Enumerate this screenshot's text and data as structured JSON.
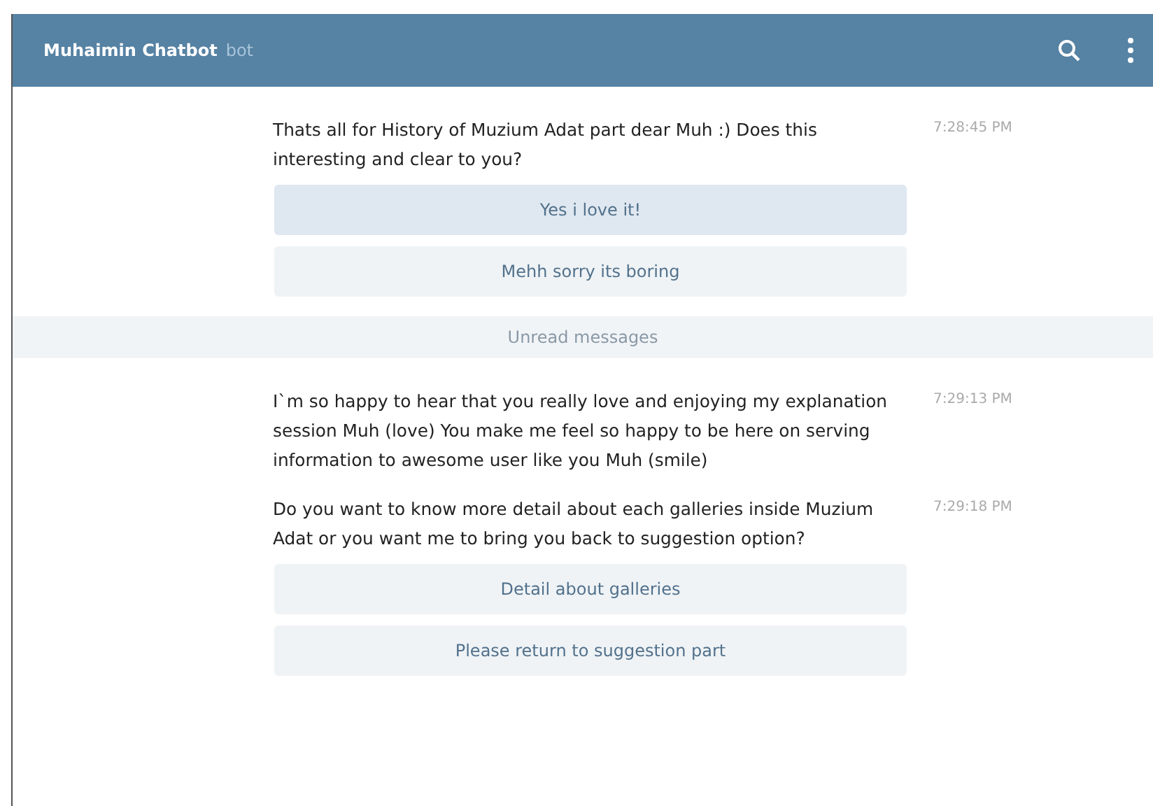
{
  "header": {
    "title": "Muhaimin Chatbot",
    "subtitle": "bot"
  },
  "messages_before": [
    {
      "text": "Thats all for History of Muzium Adat part dear Muh :) Does this interesting and clear to you?",
      "time": "7:28:45 PM",
      "buttons": [
        {
          "label": "Yes i love it!",
          "selected": true
        },
        {
          "label": "Mehh sorry its boring",
          "selected": false
        }
      ]
    }
  ],
  "divider": "Unread messages",
  "messages_after": [
    {
      "text": "I`m so happy to hear that you really love and enjoying my explanation session Muh  (love) You make me feel so happy to be here on serving information to awesome user like you Muh (smile)",
      "time": "7:29:13 PM"
    },
    {
      "text": "Do you want to know more detail about each galleries inside Muzium Adat or you want me to bring you back to suggestion option?",
      "time": "7:29:18 PM",
      "buttons": [
        {
          "label": "Detail about galleries",
          "selected": false
        },
        {
          "label": "Please return to suggestion part",
          "selected": false
        }
      ]
    }
  ]
}
